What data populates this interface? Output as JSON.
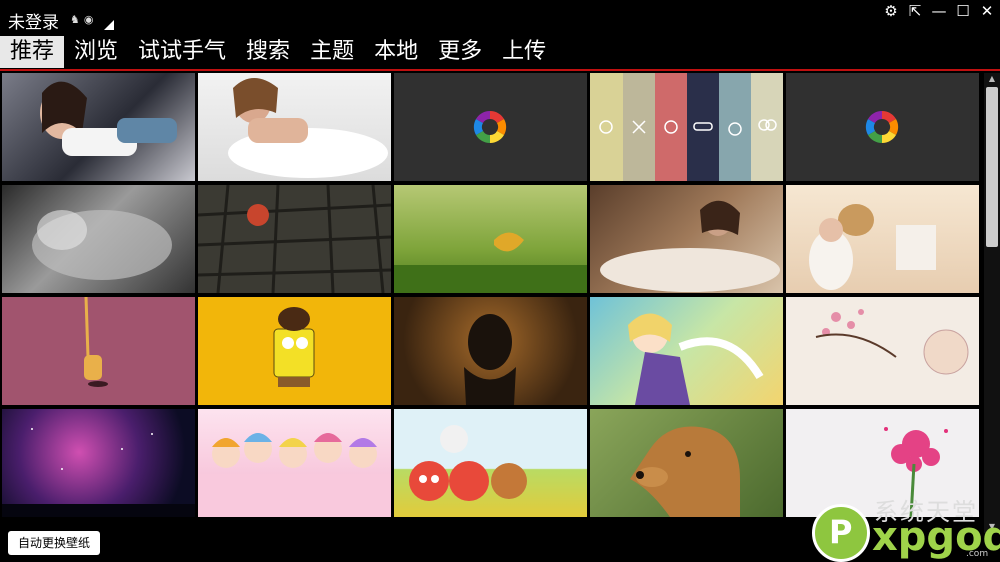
{
  "header": {
    "login_text": "未登录"
  },
  "nav": {
    "tabs": [
      {
        "label": "推荐",
        "active": true
      },
      {
        "label": "浏览"
      },
      {
        "label": "试试手气"
      },
      {
        "label": "搜索"
      },
      {
        "label": "主题"
      },
      {
        "label": "本地"
      },
      {
        "label": "更多"
      },
      {
        "label": "上传"
      }
    ]
  },
  "controls": {
    "auto_change_label": "自动更换壁纸"
  },
  "watermark": {
    "line1": "系统天堂",
    "line2": "xpgod",
    "line3": ".com",
    "logo_letter": "P"
  },
  "colors": {
    "accent": "#c01010",
    "active_tab_bg": "#e8e8e8"
  },
  "thumbnails": [
    "woman-in-shorts",
    "woman-in-white-dress",
    "loading-placeholder",
    "pastel-stripes-icons",
    "loading-placeholder",
    "black-white-portrait",
    "ball-on-cobblestone",
    "leaf-on-grass",
    "woman-in-white-gown",
    "girl-with-teddy-bear",
    "giraffe-on-pink",
    "cartoon-on-yellow",
    "person-hiding-face",
    "anime-girl",
    "flower-painting",
    "nebula-sky",
    "anime-girls-group",
    "cartoon-animals",
    "golden-retriever",
    "pink-flower-splash"
  ]
}
